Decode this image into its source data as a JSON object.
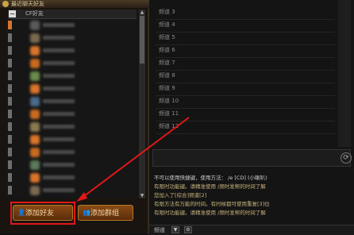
{
  "left_panel": {
    "header_title": "最近聊天好友",
    "group": {
      "toggle": "−",
      "label": "CF好友"
    },
    "friends": [
      {
        "marker": "#d9742a",
        "avatar": "#5a5a5a"
      },
      {
        "marker": "#6e6e6e",
        "avatar": "#7a6a50"
      },
      {
        "marker": "#6e6e6e",
        "avatar": "#d9742a"
      },
      {
        "marker": "#6e6e6e",
        "avatar": "#c86a20"
      },
      {
        "marker": "#6e6e6e",
        "avatar": "#6a8a4a"
      },
      {
        "marker": "#6e6e6e",
        "avatar": "#d9742a"
      },
      {
        "marker": "#6e6e6e",
        "avatar": "#4a6a8a"
      },
      {
        "marker": "#6e6e6e",
        "avatar": "#c86a20"
      },
      {
        "marker": "#6e6e6e",
        "avatar": "#8a7a50"
      },
      {
        "marker": "#6e6e6e",
        "avatar": "#d9742a"
      },
      {
        "marker": "#6e6e6e",
        "avatar": "#c86a20"
      },
      {
        "marker": "#6e6e6e",
        "avatar": "#5a7a5a"
      },
      {
        "marker": "#6e6e6e",
        "avatar": "#d9742a"
      },
      {
        "marker": "#6e6e6e",
        "avatar": "#7a6a50"
      }
    ],
    "buttons": {
      "add_friend": "添加好友",
      "add_group": "添加群组"
    }
  },
  "right_panel": {
    "channels": [
      "频道 3",
      "频道 4",
      "频道 5",
      "频道 6",
      "频道 7",
      "频道 8",
      "频道 9",
      "频道 10",
      "频道 11",
      "频道 12"
    ],
    "messages": [
      {
        "text": "不可以使用快捷键，使用方法： /e [CD] (小喇叭)",
        "white": true
      },
      {
        "text": "有限时功能键。请精准使用 /频时发帮的时间了解",
        "white": false
      },
      {
        "text": "您加入了[综合]频道[2]",
        "white": false
      },
      {
        "text": "有限方法有万能的时间。有时候都可使用重复[3]位",
        "white": false
      },
      {
        "text": "有限时功能键。请精准使用 /频时发帮的时间了解",
        "white": false
      }
    ],
    "bottom_label": "频道"
  },
  "colors": {
    "highlight": "#e01818",
    "accent": "#b07a2a"
  }
}
